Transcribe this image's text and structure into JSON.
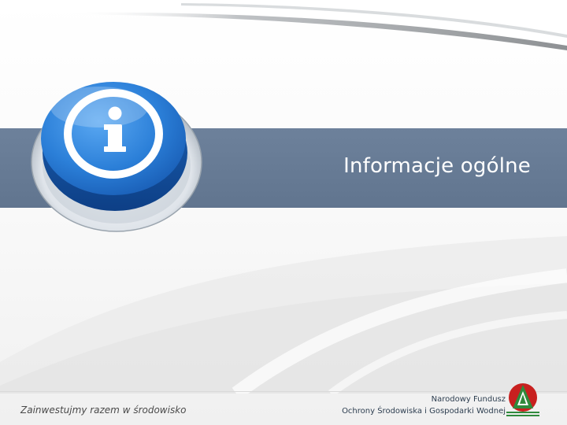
{
  "slide": {
    "title": "Informacje ogólne",
    "icon": "info-icon",
    "colors": {
      "band": "#6a7e98",
      "button_blue": "#1f6fc8",
      "button_ring": "#e7edf3"
    }
  },
  "footer": {
    "motto": "Zainwestujmy razem w środowisko",
    "org_line1": "Narodowy Fundusz",
    "org_line2": "Ochrony Środowiska i Gospodarki Wodnej",
    "logo": "nfosigw-logo",
    "logo_colors": {
      "red": "#c8201f",
      "green": "#2f8a3c"
    }
  }
}
